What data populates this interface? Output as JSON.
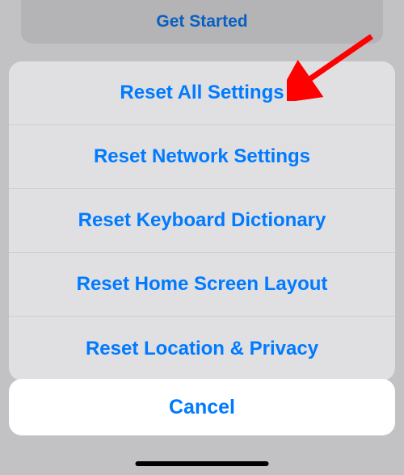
{
  "background": {
    "get_started_label": "Get Started"
  },
  "action_sheet": {
    "items": [
      {
        "label": "Reset All Settings"
      },
      {
        "label": "Reset Network Settings"
      },
      {
        "label": "Reset Keyboard Dictionary"
      },
      {
        "label": "Reset Home Screen Layout"
      },
      {
        "label": "Reset Location & Privacy"
      }
    ]
  },
  "cancel_label": "Cancel",
  "annotation": {
    "arrow_color": "#ff0000"
  }
}
